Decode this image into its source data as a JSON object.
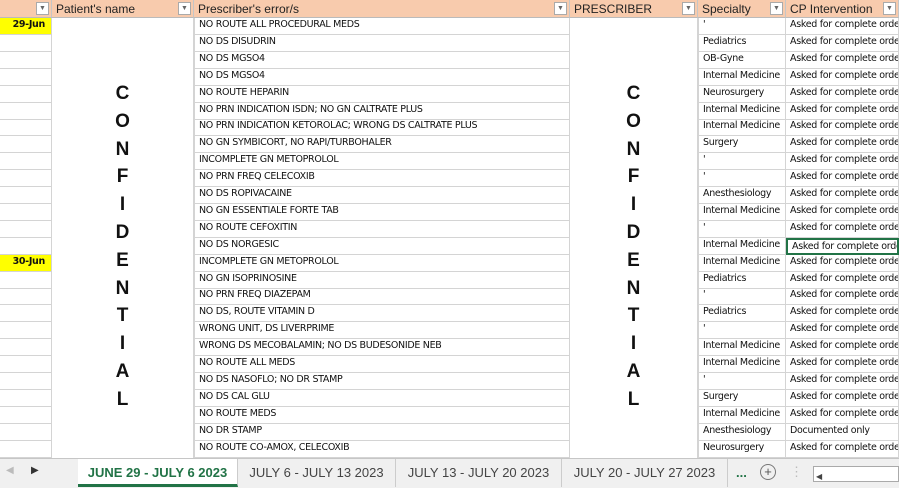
{
  "headers": {
    "a": "",
    "b": "Patient's name",
    "c": "Prescriber's error/s",
    "d": "PRESCRIBER",
    "e": "Specialty",
    "f": "CP Intervention"
  },
  "confidential_letters": [
    "C",
    "O",
    "N",
    "F",
    "I",
    "D",
    "E",
    "N",
    "T",
    "I",
    "A",
    "L"
  ],
  "rows": [
    {
      "date": "29-Jun",
      "error": "NO ROUTE ALL PROCEDURAL MEDS",
      "specialty": "'",
      "intervention": "Asked for complete order"
    },
    {
      "date": "",
      "error": "NO DS DISUDRIN",
      "specialty": "Pediatrics",
      "intervention": "Asked for complete order"
    },
    {
      "date": "",
      "error": "NO DS MGSO4",
      "specialty": "OB-Gyne",
      "intervention": "Asked for complete order"
    },
    {
      "date": "",
      "error": "NO DS MGSO4",
      "specialty": "Internal Medicine",
      "intervention": "Asked for complete order"
    },
    {
      "date": "",
      "error": "NO ROUTE HEPARIN",
      "specialty": "Neurosurgery",
      "intervention": "Asked for complete order"
    },
    {
      "date": "",
      "error": "NO PRN INDICATION ISDN; NO GN CALTRATE PLUS",
      "specialty": "Internal Medicine",
      "intervention": "Asked for complete order"
    },
    {
      "date": "",
      "error": "NO PRN INDICATION KETOROLAC; WRONG DS CALTRATE PLUS",
      "specialty": "Internal Medicine",
      "intervention": "Asked for complete order"
    },
    {
      "date": "",
      "error": "NO GN SYMBICORT, NO RAPI/TURBOHALER",
      "specialty": "Surgery",
      "intervention": "Asked for complete order"
    },
    {
      "date": "",
      "error": "INCOMPLETE GN METOPROLOL",
      "specialty": "'",
      "intervention": "Asked for complete order"
    },
    {
      "date": "",
      "error": "NO PRN FREQ CELECOXIB",
      "specialty": "'",
      "intervention": "Asked for complete order"
    },
    {
      "date": "",
      "error": "NO DS ROPIVACAINE",
      "specialty": "Anesthesiology",
      "intervention": "Asked for complete order"
    },
    {
      "date": "",
      "error": "NO GN ESSENTIALE FORTE TAB",
      "specialty": "Internal Medicine",
      "intervention": "Asked for complete order"
    },
    {
      "date": "",
      "error": "NO ROUTE CEFOXITIN",
      "specialty": "'",
      "intervention": "Asked for complete order"
    },
    {
      "date": "",
      "error": "NO DS NORGESIC",
      "specialty": "Internal Medicine",
      "intervention": "Asked for complete order"
    },
    {
      "date": "30-Jun",
      "error": "INCOMPLETE GN METOPROLOL",
      "specialty": "Internal Medicine",
      "intervention": "Asked for complete order"
    },
    {
      "date": "",
      "error": "NO GN ISOPRINOSINE",
      "specialty": "Pediatrics",
      "intervention": "Asked for complete order"
    },
    {
      "date": "",
      "error": "NO PRN FREQ DIAZEPAM",
      "specialty": "'",
      "intervention": "Asked for complete order"
    },
    {
      "date": "",
      "error": "NO DS, ROUTE VITAMIN D",
      "specialty": "Pediatrics",
      "intervention": "Asked for complete order"
    },
    {
      "date": "",
      "error": "WRONG UNIT, DS LIVERPRIME",
      "specialty": "'",
      "intervention": "Asked for complete order"
    },
    {
      "date": "",
      "error": "WRONG DS MECOBALAMIN; NO DS BUDESONIDE NEB",
      "specialty": "Internal Medicine",
      "intervention": "Asked for complete order"
    },
    {
      "date": "",
      "error": "NO ROUTE ALL MEDS",
      "specialty": "Internal Medicine",
      "intervention": "Asked for complete order"
    },
    {
      "date": "",
      "error": "NO DS NASOFLO; NO DR STAMP",
      "specialty": "'",
      "intervention": "Asked for complete order"
    },
    {
      "date": "",
      "error": "NO DS CAL GLU",
      "specialty": "Surgery",
      "intervention": "Asked for complete order"
    },
    {
      "date": "",
      "error": "NO ROUTE MEDS",
      "specialty": "Internal Medicine",
      "intervention": "Asked for complete order"
    },
    {
      "date": "",
      "error": "NO DR STAMP",
      "specialty": "Anesthesiology",
      "intervention": "Documented only"
    },
    {
      "date": "",
      "error": "NO ROUTE CO-AMOX, CELECOXIB",
      "specialty": "Neurosurgery",
      "intervention": "Asked for complete order"
    }
  ],
  "tabs": [
    "JUNE 29 - JULY 6 2023",
    "JULY 6 - JULY 13 2023",
    "JULY 13 - JULY 20 2023",
    "JULY 20 - JULY 27 2023"
  ],
  "tab_more": "...",
  "accent": "#217346"
}
